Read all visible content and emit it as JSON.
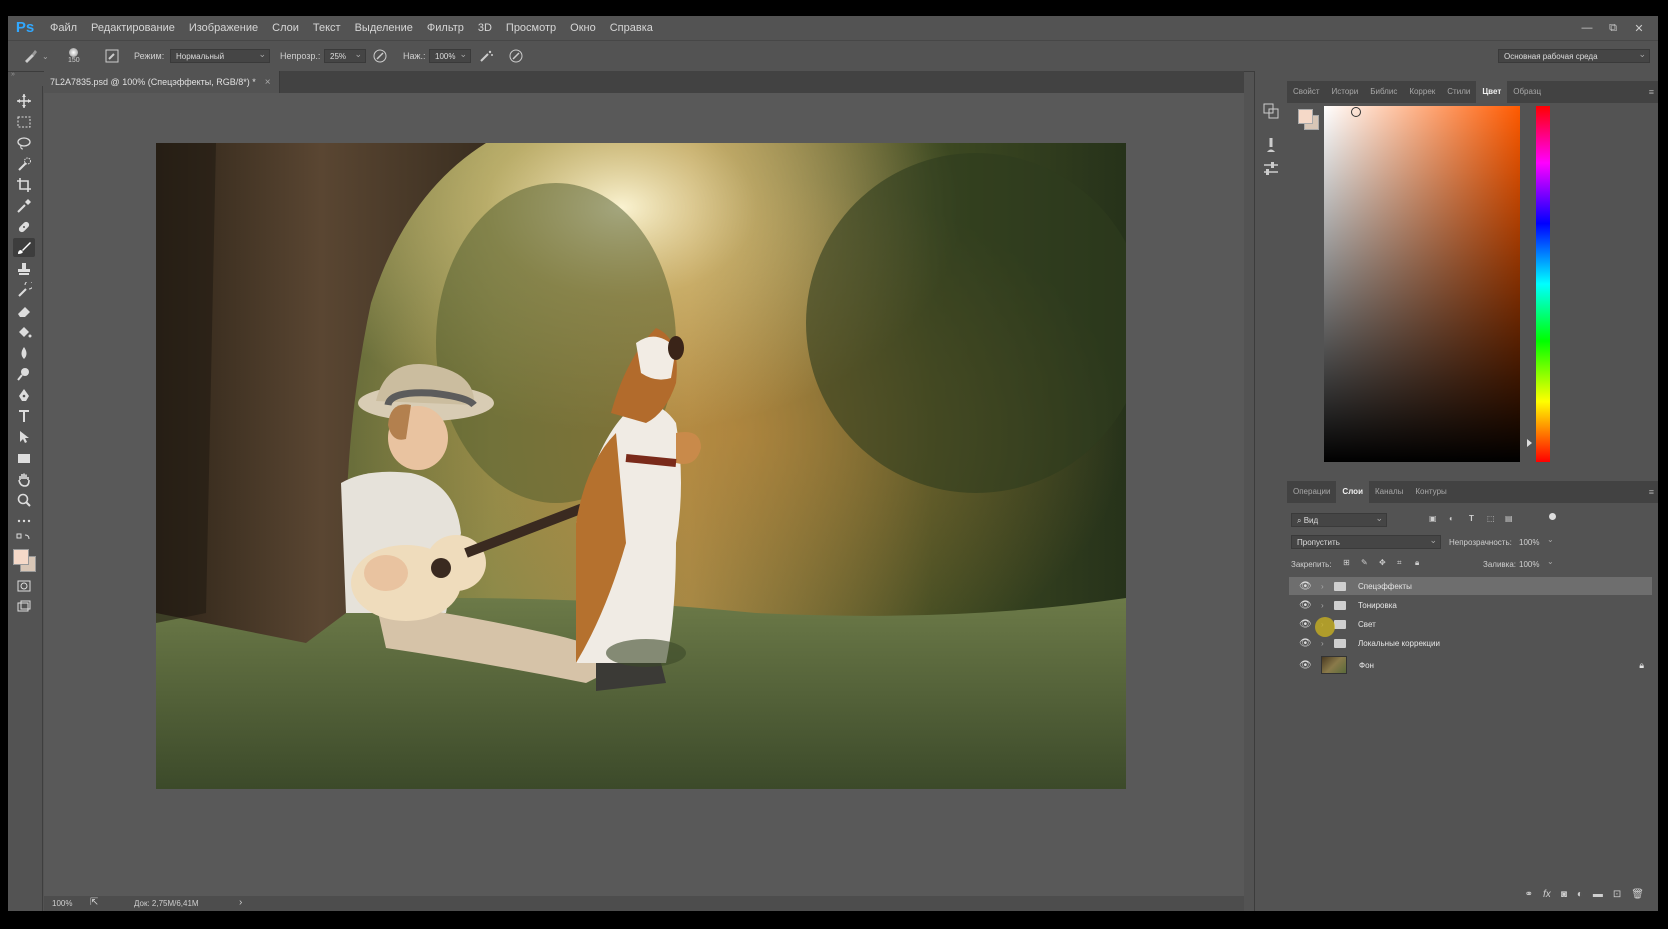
{
  "app": {
    "logo": "Ps"
  },
  "menu": [
    "Файл",
    "Редактирование",
    "Изображение",
    "Слои",
    "Текст",
    "Выделение",
    "Фильтр",
    "3D",
    "Просмотр",
    "Окно",
    "Справка"
  ],
  "window_controls": {
    "minimize": "—",
    "restore": "⧉",
    "close": "✕"
  },
  "options": {
    "brush_size": "150",
    "mode_label": "Режим:",
    "mode_value": "Нормальный",
    "opacity_label": "Непрозр.:",
    "opacity_value": "25%",
    "pressure_label": "Наж.:",
    "pressure_value": "100%",
    "workspace": "Основная рабочая среда"
  },
  "document": {
    "tab_title": "7L2A7835.psd @ 100% (Спецэффекты, RGB/8*) *",
    "close": "×",
    "zoom": "100%",
    "doc_info": "Док: 2,75M/6,41M",
    "status_arrow": "›"
  },
  "color_panel": {
    "tabs": [
      "Свойст",
      "Истори",
      "Библис",
      "Коррек",
      "Стили",
      "Цвет",
      "Образц"
    ],
    "active_tab": "Цвет",
    "foreground": "#f5d9c8",
    "background": "#d8c6b6",
    "hue_color": "#ff5a00"
  },
  "layers_panel": {
    "tabs": [
      "Операции",
      "Слои",
      "Каналы",
      "Контуры"
    ],
    "active_tab": "Слои",
    "filter_label": "Вид",
    "blend_mode": "Пропустить",
    "opacity_label": "Непрозрачность:",
    "opacity_value": "100%",
    "lock_label": "Закрепить:",
    "fill_label": "Заливка:",
    "fill_value": "100%",
    "layers": [
      {
        "name": "Спецэффекты",
        "type": "group",
        "selected": true
      },
      {
        "name": "Тонировка",
        "type": "group",
        "selected": false
      },
      {
        "name": "Свет",
        "type": "group",
        "selected": false
      },
      {
        "name": "Локальные коррекции",
        "type": "group",
        "selected": false
      },
      {
        "name": "Фон",
        "type": "image",
        "selected": false,
        "locked": true
      }
    ],
    "bottom_icons": [
      "link-icon",
      "fx-icon",
      "mask-icon",
      "adjustment-icon",
      "group-icon",
      "new-layer-icon",
      "trash-icon"
    ]
  }
}
